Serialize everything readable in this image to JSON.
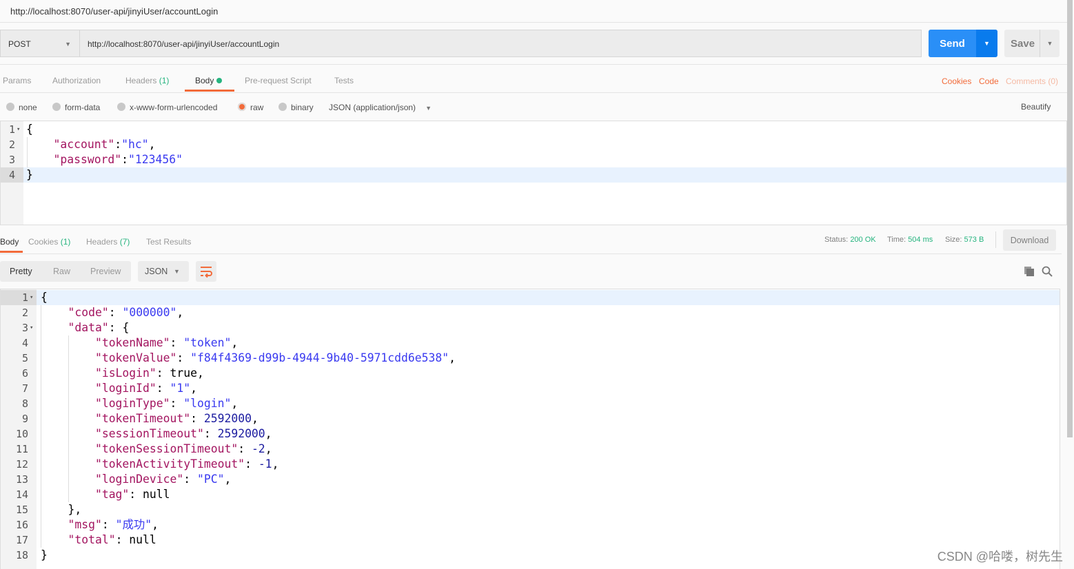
{
  "window": {
    "title": "http://localhost:8070/user-api/jinyiUser/accountLogin"
  },
  "request": {
    "method": "POST",
    "url": "http://localhost:8070/user-api/jinyiUser/accountLogin",
    "send_label": "Send",
    "save_label": "Save",
    "tabs": [
      {
        "label": "Params"
      },
      {
        "label": "Authorization"
      },
      {
        "label": "Headers",
        "count": "(1)"
      },
      {
        "label": "Body"
      },
      {
        "label": "Pre-request Script"
      },
      {
        "label": "Tests"
      }
    ],
    "links": {
      "cookies": "Cookies",
      "code": "Code",
      "comments": "Comments (0)"
    },
    "body_types": [
      "none",
      "form-data",
      "x-www-form-urlencoded",
      "raw",
      "binary"
    ],
    "selected_body_type": "raw",
    "content_type": "JSON (application/json)",
    "beautify": "Beautify",
    "lines": [
      [
        {
          "t": "{",
          "c": "p"
        }
      ],
      [
        {
          "t": "    ",
          "c": "p"
        },
        {
          "t": "\"account\"",
          "c": "k"
        },
        {
          "t": ":",
          "c": "p"
        },
        {
          "t": "\"hc\"",
          "c": "s"
        },
        {
          "t": ",",
          "c": "p"
        }
      ],
      [
        {
          "t": "    ",
          "c": "p"
        },
        {
          "t": "\"password\"",
          "c": "k"
        },
        {
          "t": ":",
          "c": "p"
        },
        {
          "t": "\"123456\"",
          "c": "s"
        }
      ],
      [
        {
          "t": "}",
          "c": "p"
        }
      ]
    ]
  },
  "response": {
    "tabs": [
      {
        "label": "Body"
      },
      {
        "label": "Cookies",
        "count": "(1)"
      },
      {
        "label": "Headers",
        "count": "(7)"
      },
      {
        "label": "Test Results"
      }
    ],
    "status_label": "Status:",
    "status": "200 OK",
    "time_label": "Time:",
    "time": "504 ms",
    "size_label": "Size:",
    "size": "573 B",
    "download": "Download",
    "views": [
      "Pretty",
      "Raw",
      "Preview"
    ],
    "format": "JSON",
    "lines": [
      [
        {
          "t": "{",
          "c": "p"
        }
      ],
      [
        {
          "t": "    ",
          "c": "p"
        },
        {
          "t": "\"code\"",
          "c": "k"
        },
        {
          "t": ": ",
          "c": "p"
        },
        {
          "t": "\"000000\"",
          "c": "s"
        },
        {
          "t": ",",
          "c": "p"
        }
      ],
      [
        {
          "t": "    ",
          "c": "p"
        },
        {
          "t": "\"data\"",
          "c": "k"
        },
        {
          "t": ": {",
          "c": "p"
        }
      ],
      [
        {
          "t": "        ",
          "c": "p"
        },
        {
          "t": "\"tokenName\"",
          "c": "k"
        },
        {
          "t": ": ",
          "c": "p"
        },
        {
          "t": "\"token\"",
          "c": "s"
        },
        {
          "t": ",",
          "c": "p"
        }
      ],
      [
        {
          "t": "        ",
          "c": "p"
        },
        {
          "t": "\"tokenValue\"",
          "c": "k"
        },
        {
          "t": ": ",
          "c": "p"
        },
        {
          "t": "\"f84f4369-d99b-4944-9b40-5971cdd6e538\"",
          "c": "s"
        },
        {
          "t": ",",
          "c": "p"
        }
      ],
      [
        {
          "t": "        ",
          "c": "p"
        },
        {
          "t": "\"isLogin\"",
          "c": "k"
        },
        {
          "t": ": true,",
          "c": "p"
        }
      ],
      [
        {
          "t": "        ",
          "c": "p"
        },
        {
          "t": "\"loginId\"",
          "c": "k"
        },
        {
          "t": ": ",
          "c": "p"
        },
        {
          "t": "\"1\"",
          "c": "s"
        },
        {
          "t": ",",
          "c": "p"
        }
      ],
      [
        {
          "t": "        ",
          "c": "p"
        },
        {
          "t": "\"loginType\"",
          "c": "k"
        },
        {
          "t": ": ",
          "c": "p"
        },
        {
          "t": "\"login\"",
          "c": "s"
        },
        {
          "t": ",",
          "c": "p"
        }
      ],
      [
        {
          "t": "        ",
          "c": "p"
        },
        {
          "t": "\"tokenTimeout\"",
          "c": "k"
        },
        {
          "t": ": ",
          "c": "p"
        },
        {
          "t": "2592000",
          "c": "n"
        },
        {
          "t": ",",
          "c": "p"
        }
      ],
      [
        {
          "t": "        ",
          "c": "p"
        },
        {
          "t": "\"sessionTimeout\"",
          "c": "k"
        },
        {
          "t": ": ",
          "c": "p"
        },
        {
          "t": "2592000",
          "c": "n"
        },
        {
          "t": ",",
          "c": "p"
        }
      ],
      [
        {
          "t": "        ",
          "c": "p"
        },
        {
          "t": "\"tokenSessionTimeout\"",
          "c": "k"
        },
        {
          "t": ": ",
          "c": "p"
        },
        {
          "t": "-2",
          "c": "n"
        },
        {
          "t": ",",
          "c": "p"
        }
      ],
      [
        {
          "t": "        ",
          "c": "p"
        },
        {
          "t": "\"tokenActivityTimeout\"",
          "c": "k"
        },
        {
          "t": ": ",
          "c": "p"
        },
        {
          "t": "-1",
          "c": "n"
        },
        {
          "t": ",",
          "c": "p"
        }
      ],
      [
        {
          "t": "        ",
          "c": "p"
        },
        {
          "t": "\"loginDevice\"",
          "c": "k"
        },
        {
          "t": ": ",
          "c": "p"
        },
        {
          "t": "\"PC\"",
          "c": "s"
        },
        {
          "t": ",",
          "c": "p"
        }
      ],
      [
        {
          "t": "        ",
          "c": "p"
        },
        {
          "t": "\"tag\"",
          "c": "k"
        },
        {
          "t": ": null",
          "c": "p"
        }
      ],
      [
        {
          "t": "    },",
          "c": "p"
        }
      ],
      [
        {
          "t": "    ",
          "c": "p"
        },
        {
          "t": "\"msg\"",
          "c": "k"
        },
        {
          "t": ": ",
          "c": "p"
        },
        {
          "t": "\"成功\"",
          "c": "s"
        },
        {
          "t": ",",
          "c": "p"
        }
      ],
      [
        {
          "t": "    ",
          "c": "p"
        },
        {
          "t": "\"total\"",
          "c": "k"
        },
        {
          "t": ": null",
          "c": "p"
        }
      ],
      [
        {
          "t": "}",
          "c": "p"
        }
      ]
    ]
  },
  "colors": {
    "accent": "#f26b3a",
    "send": "#2a8ff7",
    "success": "#26b47f"
  },
  "watermark": "CSDN @哈喽，树先生"
}
